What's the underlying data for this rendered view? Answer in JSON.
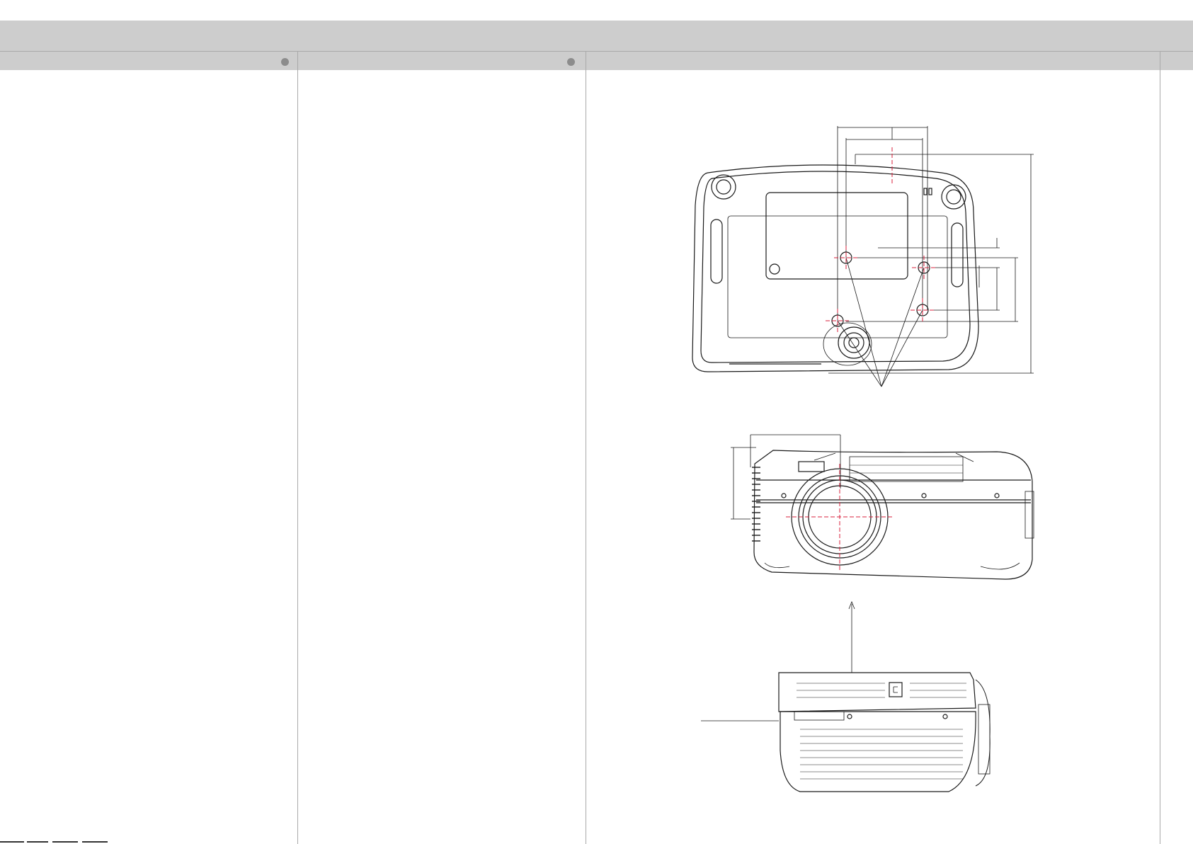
{
  "page": {
    "footer_text": "",
    "columns": [
      {
        "label": "",
        "has_dot": true
      },
      {
        "label": "",
        "has_dot": true
      },
      {
        "label": "",
        "has_dot": false
      }
    ]
  },
  "figure": {
    "views": [
      "bottom-view",
      "front-view",
      "rear-view"
    ],
    "accent_color": "#d9203c",
    "line_color": "#1a1a1a"
  }
}
